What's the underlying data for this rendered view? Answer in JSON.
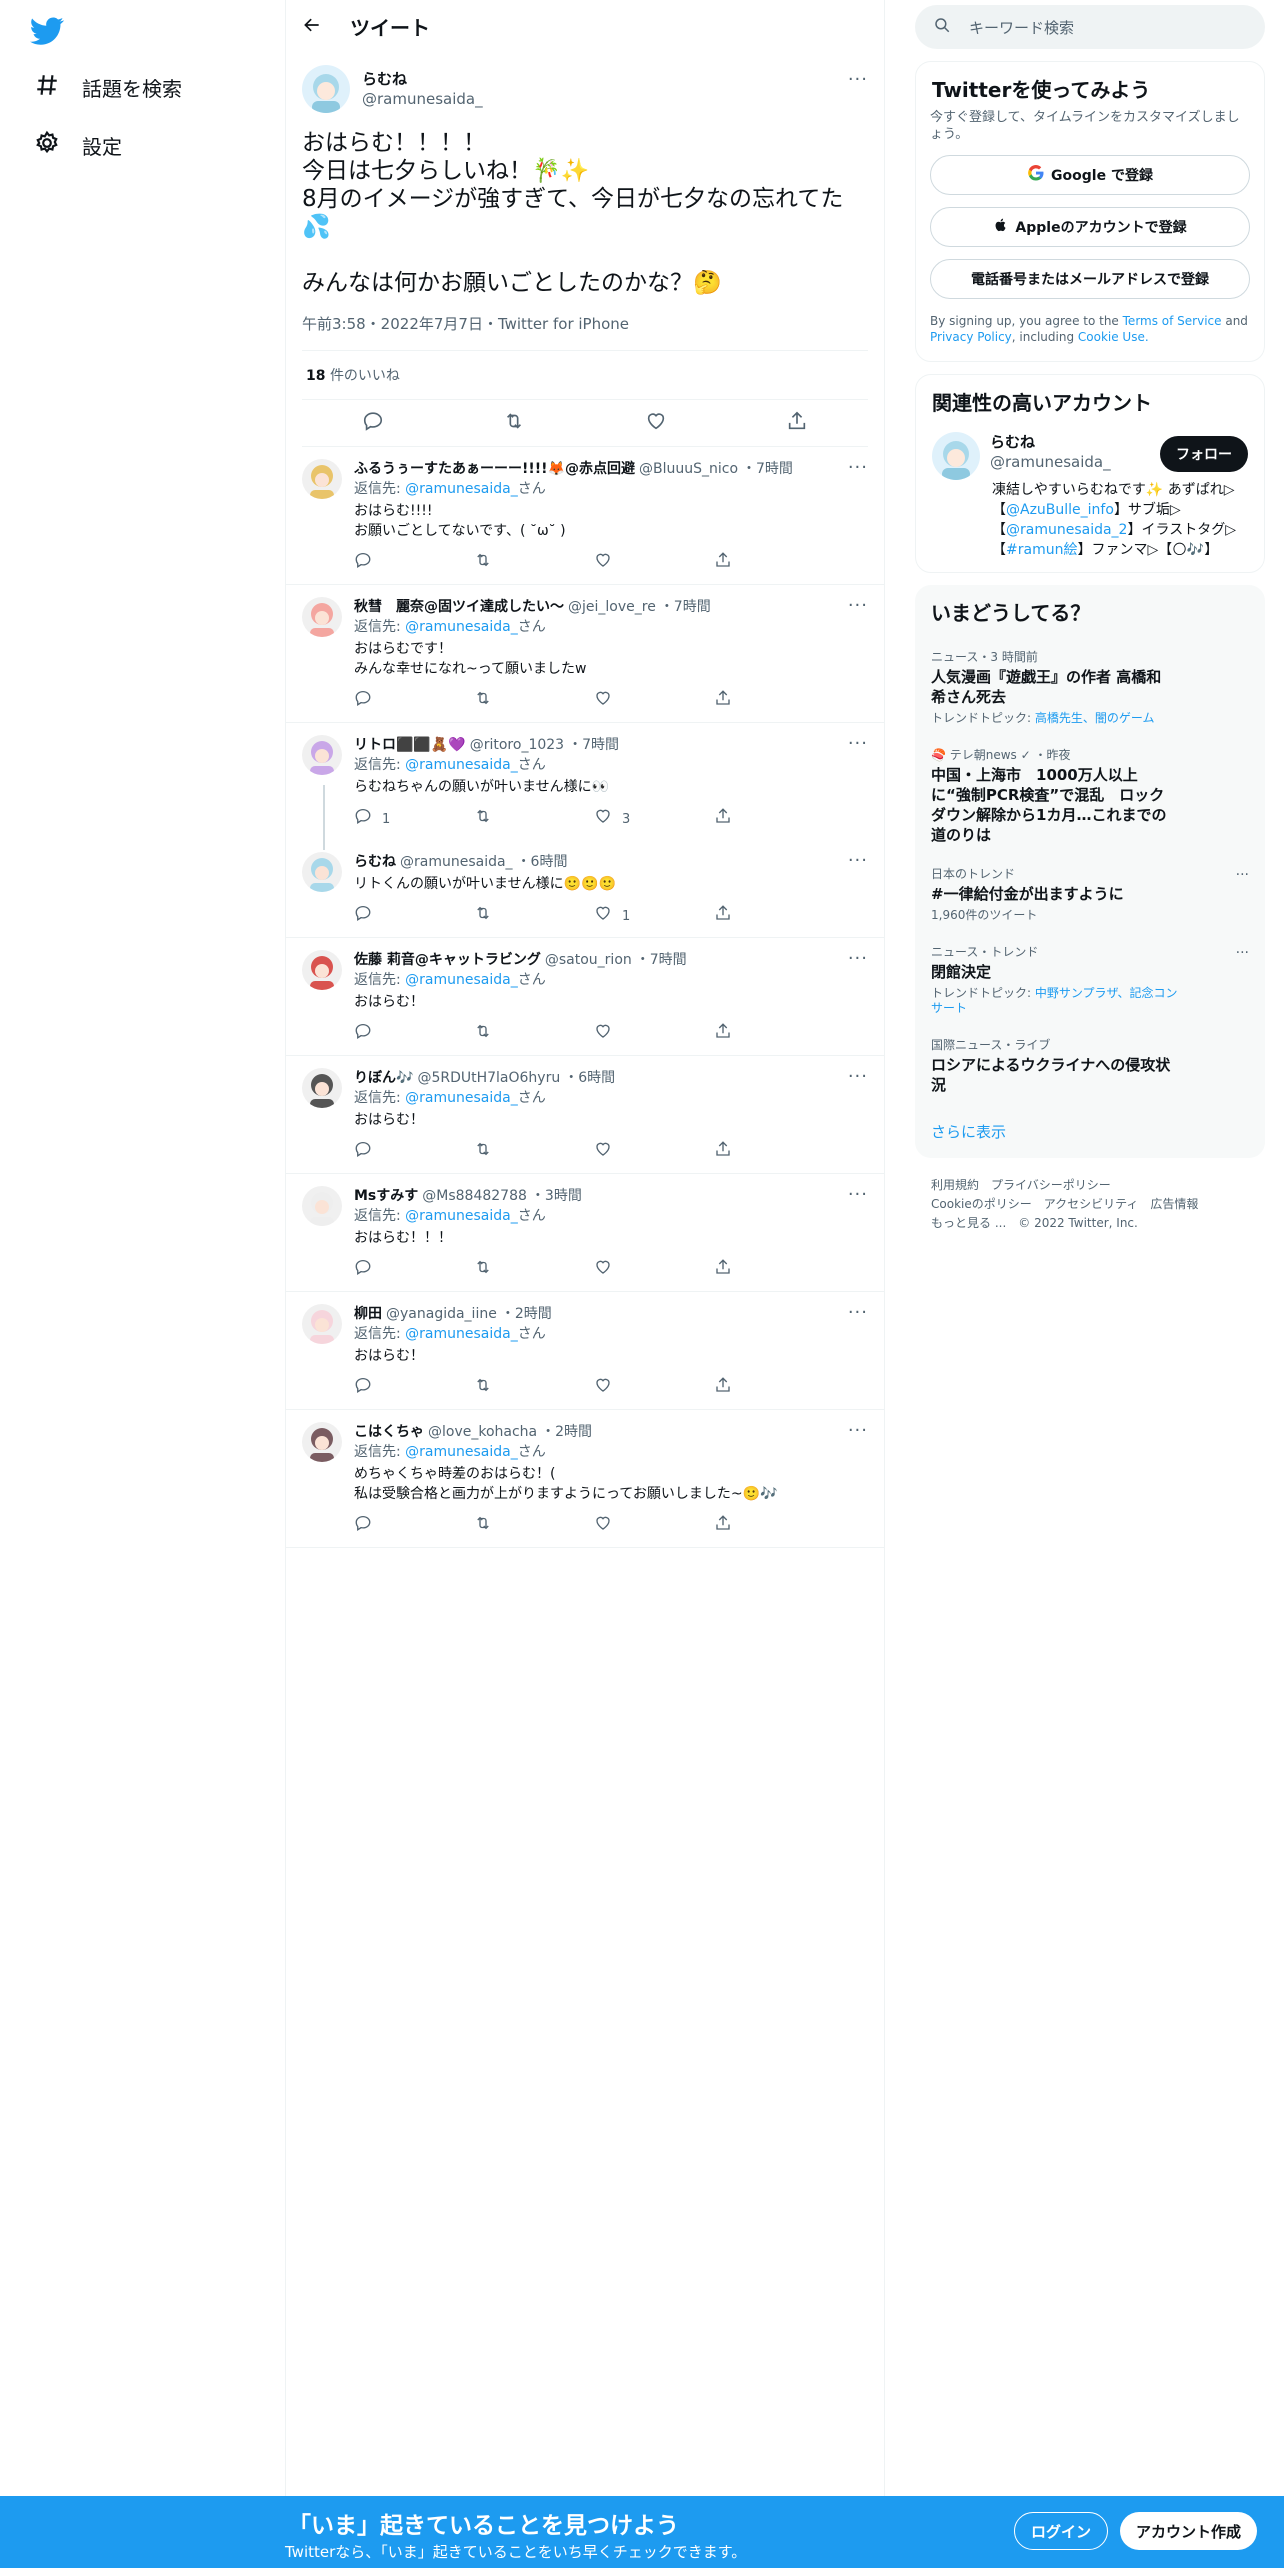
{
  "nav": {
    "explore_label": "話題を検索",
    "settings_label": "設定"
  },
  "header": {
    "title": "ツイート"
  },
  "focal": {
    "name": "らむね",
    "handle": "@ramunesaida_",
    "text": "おはらむ！！！！\n今日は七夕らしいね！🎋✨\n8月のイメージが強すぎて、今日が七夕なの忘れてた💦\n\nみんなは何かお願いごとしたのかな？🤔",
    "meta": "午前3:58・2022年7月7日・Twitter for iPhone",
    "likes_count": "18",
    "likes_label": "件のいいね"
  },
  "replies": [
    {
      "name": "ふるうぅーすたあぁーーー!!!!🦊@赤点回避",
      "handle": "@BluuuS_nico",
      "time": "・7時間",
      "reply_prefix": "返信先: ",
      "reply_to": "@ramunesaida_",
      "reply_suffix": "さん",
      "text": "おはらむ!!!!\nお願いごとしてないです、( ˘ω˘ )",
      "reply_count": "",
      "like_count": "",
      "avatar_color": "#e9c46a"
    },
    {
      "name": "秋彗　麗奈@固ツイ達成したい〜",
      "handle": "@jei_love_re",
      "time": "・7時間",
      "reply_prefix": "返信先: ",
      "reply_to": "@ramunesaida_",
      "reply_suffix": "さん",
      "text": "おはらむです！\nみんな幸せになれ~って願いましたw",
      "reply_count": "",
      "like_count": "",
      "avatar_color": "#f4a6a0"
    },
    {
      "name": "リトロ⬛⬛🧸💜",
      "handle": "@ritoro_1023",
      "time": "・7時間",
      "reply_prefix": "返信先: ",
      "reply_to": "@ramunesaida_",
      "reply_suffix": "さん",
      "text": "らむねちゃんの願いが叶いません様に👀",
      "reply_count": "1",
      "like_count": "3",
      "avatar_color": "#c9a7e8"
    },
    {
      "name": "らむね",
      "handle": "@ramunesaida_",
      "time": "・6時間",
      "reply_prefix": "",
      "reply_to": "",
      "reply_suffix": "",
      "text": "リトくんの願いが叶いません様に🙂🙂🙂",
      "reply_count": "",
      "like_count": "1",
      "avatar_color": "#a8d8ea"
    },
    {
      "name": "佐藤 莉音@キャットラビング",
      "handle": "@satou_rion",
      "time": "・7時間",
      "reply_prefix": "返信先: ",
      "reply_to": "@ramunesaida_",
      "reply_suffix": "さん",
      "text": "おはらむ！",
      "reply_count": "",
      "like_count": "",
      "avatar_color": "#d9534f"
    },
    {
      "name": "りぼん🎶",
      "handle": "@5RDUtH7laO6hyru",
      "time": "・6時間",
      "reply_prefix": "返信先: ",
      "reply_to": "@ramunesaida_",
      "reply_suffix": "さん",
      "text": "おはらむ！",
      "reply_count": "",
      "like_count": "",
      "avatar_color": "#555555"
    },
    {
      "name": "Msすみす",
      "handle": "@Ms88482788",
      "time": "・3時間",
      "reply_prefix": "返信先: ",
      "reply_to": "@ramunesaida_",
      "reply_suffix": "さん",
      "text": "おはらむ！！！",
      "reply_count": "",
      "like_count": "",
      "avatar_color": "#eeeeee"
    },
    {
      "name": "柳田",
      "handle": "@yanagida_iine",
      "time": "・2時間",
      "reply_prefix": "返信先: ",
      "reply_to": "@ramunesaida_",
      "reply_suffix": "さん",
      "text": "おはらむ！",
      "reply_count": "",
      "like_count": "",
      "avatar_color": "#f6d5dc"
    },
    {
      "name": "こはくちゃ",
      "handle": "@love_kohacha",
      "time": "・2時間",
      "reply_prefix": "返信先: ",
      "reply_to": "@ramunesaida_",
      "reply_suffix": "さん",
      "text": "めちゃくちゃ時差のおはらむ！(\n私は受験合格と画力が上がりますようにってお願いしました~🙂🎶",
      "reply_count": "",
      "like_count": "",
      "avatar_color": "#7a5c61"
    }
  ],
  "right": {
    "search_placeholder": "キーワード検索",
    "signup_card": {
      "title": "Twitterを使ってみよう",
      "subtitle": "今すぐ登録して、タイムラインをカスタマイズしましょう。",
      "google_label": "Google で登録",
      "apple_label": "Appleのアカウントで登録",
      "phone_label": "電話番号またはメールアドレスで登録",
      "terms_prefix": "By signing up, you agree to the ",
      "terms_link": "Terms of Service",
      "terms_and": " and ",
      "privacy_link": "Privacy Policy",
      "terms_including": ", including ",
      "cookie_link": "Cookie Use."
    },
    "related": {
      "title": "関連性の高いアカウント",
      "name": "らむね",
      "handle": "@ramunesaida_",
      "follow_label": "フォロー",
      "bio_1": "凍結しやすいらむねです✨ あずぱれ▷【",
      "bio_link1": "@AzuBulle_info",
      "bio_2": "】サブ垢▷【",
      "bio_link2": "@ramunesaida_2",
      "bio_3": "】イラストタグ▷【",
      "bio_link3": "#ramun絵",
      "bio_4": "】ファンマ▷【🌕🎶】"
    },
    "trends": {
      "title": "いまどうしてる？",
      "items": [
        {
          "context": "ニュース・3 時間前",
          "title": "人気漫画『遊戯王』の作者 高橋和希さん死去",
          "sub_prefix": "トレンドトピック: ",
          "sub_link": "高橋先生、闇のゲーム",
          "more": ""
        },
        {
          "context": "🍣 テレ朝news ✓ ・昨夜",
          "title": "中国・上海市　1000万人以上に“強制PCR検査”で混乱　ロックダウン解除から1カ月…これまでの道のりは",
          "sub_prefix": "",
          "sub_link": "",
          "more": ""
        },
        {
          "context": "日本のトレンド",
          "title": "#一律給付金が出ますように",
          "sub_prefix": "1,960件のツイート",
          "sub_link": "",
          "more": "···"
        },
        {
          "context": "ニュース・トレンド",
          "title": "閉館決定",
          "sub_prefix": "トレンドトピック: ",
          "sub_link": "中野サンプラザ、記念コンサート",
          "more": "···"
        },
        {
          "context": "国際ニュース・ライブ",
          "title": "ロシアによるウクライナへの侵攻状況",
          "sub_prefix": "",
          "sub_link": "",
          "more": ""
        }
      ],
      "show_more": "さらに表示"
    },
    "footer": {
      "line1": "利用規約　プライバシーポリシー",
      "line2": "Cookieのポリシー　アクセシビリティ　広告情報",
      "line3": "もっと見る ...　© 2022 Twitter, Inc."
    }
  },
  "bottom": {
    "title": "「いま」起きていることを見つけよう",
    "subtitle": "Twitterなら、「いま」起きていることをいち早くチェックできます。",
    "login_label": "ログイン",
    "signup_label": "アカウント作成"
  },
  "colors": {
    "brand": "#1d9bf0",
    "text": "#0f1419",
    "muted": "#536471"
  }
}
